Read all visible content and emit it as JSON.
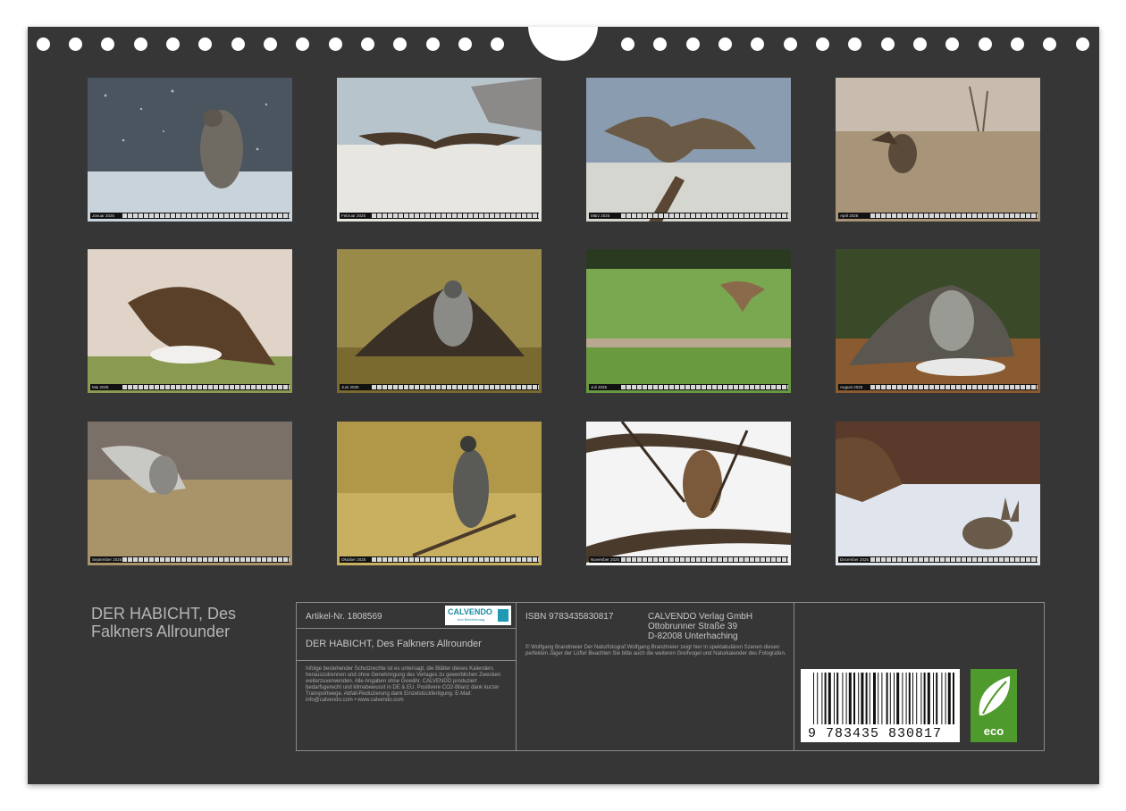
{
  "calendar_title": "DER HABICHT, Des Falkners Allrounder",
  "months": [
    {
      "label": "Januar 2025",
      "scene": "Goshawk on snowy ground in falling snow"
    },
    {
      "label": "Februar 2025",
      "scene": "Goshawk with spread wings low over snow"
    },
    {
      "label": "März 2025",
      "scene": "Goshawk landing on a branch"
    },
    {
      "label": "April 2025",
      "scene": "Goshawk taking off in dry reeds"
    },
    {
      "label": "Mai 2025",
      "scene": "Young goshawk mantling over prey"
    },
    {
      "label": "Juni 2025",
      "scene": "Goshawk mantling prey in autumn light"
    },
    {
      "label": "Juli 2025",
      "scene": "Goshawk flying low over green meadow"
    },
    {
      "label": "August 2025",
      "scene": "Goshawk with prey on forest floor"
    },
    {
      "label": "September 2025",
      "scene": "Goshawk in field with prey"
    },
    {
      "label": "Oktober 2025",
      "scene": "Goshawk perched on a branch"
    },
    {
      "label": "November 2025",
      "scene": "Juvenile goshawk in bare tree"
    },
    {
      "label": "Dezember 2025",
      "scene": "Goshawk with rabbit in snow"
    }
  ],
  "info": {
    "article": "Artikel-Nr. 1808569",
    "brand": "CALVENDO",
    "brand_sub": "bon Bercheinung",
    "subtitle": "DER HABICHT, Des Falkners Allrounder",
    "fine_print": "Infolge bestehender Schutzrechte ist es untersagt, die Blätter dieses Kalenders herauszutrennen und ohne Genehmigung des Verlages zu gewerblichen Zwecken weiterzuverwenden. Alle Angaben ohne Gewähr. CALVENDO produziert bedarfsgerecht und klimabewusst in DE & EU. Positivere CO2-Bilanz dank kurzer Transportwege. Abfall-Reduzierung dank Einzelstückfertigung. E-Mail: info@calvendo.com • www.calvendo.com",
    "isbn": "ISBN 9783435830817",
    "publisher_line1": "CALVENDO Verlag GmbH",
    "publisher_line2": "Ottobrunner Straße 39",
    "publisher_line3": "D-82008 Unterhaching",
    "description": "© Wolfgang Brandmeier Der Naturfotograf Wolfgang Brandmeier zeigt hier in spektakulären Szenen diesen perfekten Jäger der Lüfte! Beachten Sie bitte auch die weiteren Greifvogel und Naturkalender des Fotografen.",
    "barcode_number": "9 783435 830817",
    "eco_label": "eco"
  },
  "colors": {
    "page_background": "#363636",
    "text_light": "#c8c8c8",
    "border": "#8a8a8a",
    "eco_green": "#4f9a2c",
    "brand_teal": "#1a8aa0"
  }
}
